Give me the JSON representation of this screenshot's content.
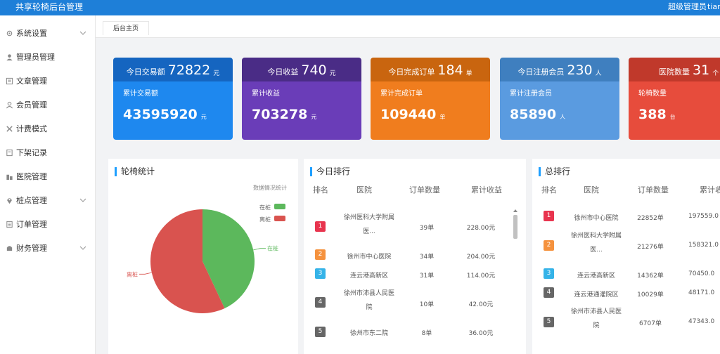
{
  "header": {
    "app_title": "共享轮椅后台管理",
    "user_role": "超级管理员",
    "user_name": "tian"
  },
  "sidebar": {
    "items": [
      {
        "label": "系统设置",
        "icon": "gear-icon",
        "expandable": true
      },
      {
        "label": "管理员管理",
        "icon": "user-icon",
        "expandable": false
      },
      {
        "label": "文章管理",
        "icon": "article-icon",
        "expandable": false
      },
      {
        "label": "会员管理",
        "icon": "member-icon",
        "expandable": false
      },
      {
        "label": "计费模式",
        "icon": "tools-icon",
        "expandable": false
      },
      {
        "label": "下架记录",
        "icon": "record-icon",
        "expandable": false
      },
      {
        "label": "医院管理",
        "icon": "hospital-icon",
        "expandable": false
      },
      {
        "label": "桩点管理",
        "icon": "location-pin-icon",
        "expandable": true
      },
      {
        "label": "订单管理",
        "icon": "order-icon",
        "expandable": false
      },
      {
        "label": "财务管理",
        "icon": "finance-icon",
        "expandable": true
      }
    ]
  },
  "tabs": {
    "home_label": "后台主页"
  },
  "cards": [
    {
      "head_label": "今日交易额",
      "head_value": "72822",
      "head_unit": "元",
      "sub_label": "累计交易额",
      "total": "43595920",
      "total_unit": "元",
      "color_head": "#1565c0",
      "color_body": "#1e88ef"
    },
    {
      "head_label": "今日收益",
      "head_value": "740",
      "head_unit": "元",
      "sub_label": "累计收益",
      "total": "703278",
      "total_unit": "元",
      "color_head": "#4a2c86",
      "color_body": "#6a3db8"
    },
    {
      "head_label": "今日完成订单",
      "head_value": "184",
      "head_unit": "单",
      "sub_label": "累计完成订单",
      "total": "109440",
      "total_unit": "单",
      "color_head": "#c9650f",
      "color_body": "#f07d1e"
    },
    {
      "head_label": "今日注册会员",
      "head_value": "230",
      "head_unit": "人",
      "sub_label": "累计注册会员",
      "total": "85890",
      "total_unit": "人",
      "color_head": "#3f7fbf",
      "color_body": "#5a9be0"
    },
    {
      "head_label": "医院数量",
      "head_value": "31",
      "head_unit": "个",
      "sub_label": "轮椅数量",
      "total": "388",
      "total_unit": "台",
      "color_head": "#c0392b",
      "color_body": "#e74c3c"
    }
  ],
  "wheelchair_stats": {
    "title": "轮椅统计",
    "subtitle": "数据情况统计",
    "legend": [
      {
        "label": "在桩",
        "color": "#5cb85c"
      },
      {
        "label": "离桩",
        "color": "#d9534f"
      }
    ]
  },
  "chart_data": {
    "type": "pie",
    "title": "数据情况统计",
    "slices": [
      {
        "label": "在桩",
        "value": 43,
        "color": "#5cb85c"
      },
      {
        "label": "离桩",
        "value": 57,
        "color": "#d9534f"
      }
    ]
  },
  "today_rank": {
    "title": "今日排行",
    "headers": [
      "排名",
      "医院",
      "订单数量",
      "累计收益"
    ],
    "rows": [
      {
        "rank": "1",
        "hospital_l1": "徐州医科大学附属",
        "hospital_l2": "医...",
        "orders": "39单",
        "revenue": "228.00元",
        "color": "#e8344e"
      },
      {
        "rank": "2",
        "hospital_l1": "徐州市中心医院",
        "hospital_l2": "",
        "orders": "34单",
        "revenue": "204.00元",
        "color": "#f5923e"
      },
      {
        "rank": "3",
        "hospital_l1": "连云港高新区",
        "hospital_l2": "",
        "orders": "31单",
        "revenue": "114.00元",
        "color": "#35b3e8"
      },
      {
        "rank": "4",
        "hospital_l1": "徐州市沛县人民医",
        "hospital_l2": "院",
        "orders": "10单",
        "revenue": "42.00元",
        "color": "#666666"
      },
      {
        "rank": "5",
        "hospital_l1": "徐州市东二院",
        "hospital_l2": "",
        "orders": "8单",
        "revenue": "36.00元",
        "color": "#666666"
      }
    ]
  },
  "total_rank": {
    "title": "总排行",
    "headers": [
      "排名",
      "医院",
      "订单数量",
      "累计收"
    ],
    "rows": [
      {
        "rank": "1",
        "hospital_l1": "徐州市中心医院",
        "hospital_l2": "",
        "orders": "22852单",
        "revenue": "197559.0",
        "color": "#e8344e"
      },
      {
        "rank": "2",
        "hospital_l1": "徐州医科大学附属",
        "hospital_l2": "医...",
        "orders": "21276单",
        "revenue": "158321.0",
        "color": "#f5923e"
      },
      {
        "rank": "3",
        "hospital_l1": "连云港高新区",
        "hospital_l2": "",
        "orders": "14362单",
        "revenue": "70450.0",
        "color": "#35b3e8"
      },
      {
        "rank": "4",
        "hospital_l1": "连云港通灌院区",
        "hospital_l2": "",
        "orders": "10029单",
        "revenue": "48171.0",
        "color": "#666666"
      },
      {
        "rank": "5",
        "hospital_l1": "徐州市沛县人民医",
        "hospital_l2": "院",
        "orders": "6707单",
        "revenue": "47343.0",
        "color": "#666666"
      }
    ]
  }
}
